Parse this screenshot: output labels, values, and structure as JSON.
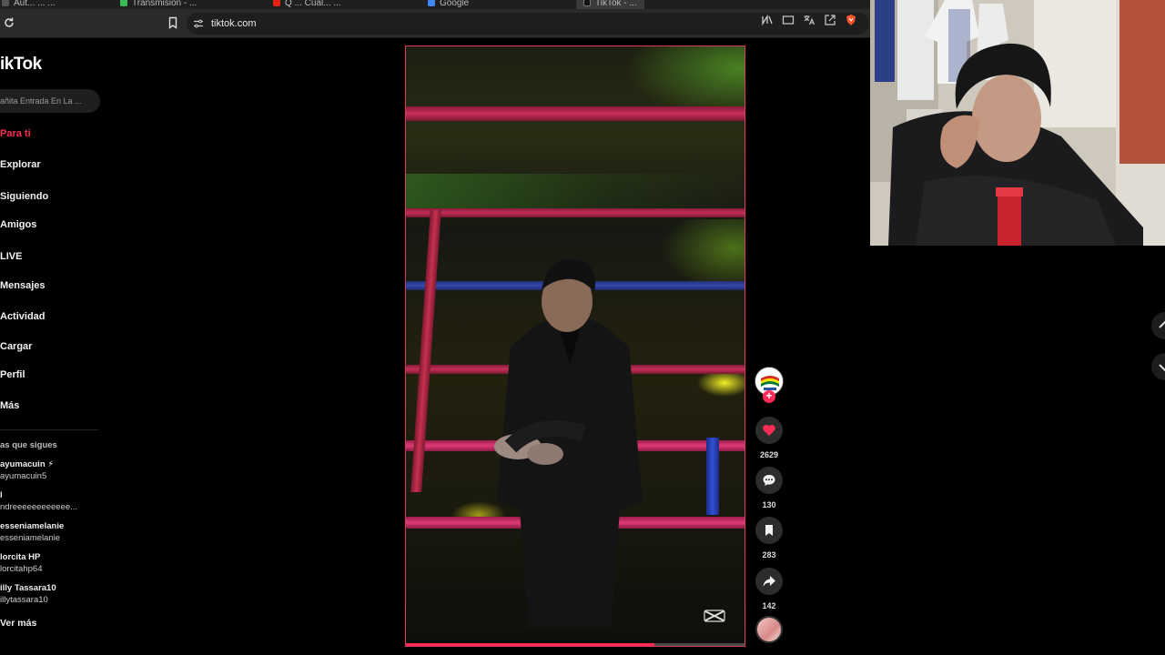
{
  "browser": {
    "tabs": [
      {
        "label": "Aut... ...   ...",
        "active": false
      },
      {
        "label": "Transmisión - ...",
        "active": false
      },
      {
        "label": "Q ... Cual... ...",
        "active": false
      },
      {
        "label": "Google",
        "active": false
      },
      {
        "label": "TikTok - ...",
        "active": true
      }
    ],
    "url": "tiktok.com"
  },
  "sidebar": {
    "logo": "ikTok",
    "search_placeholder": "añita Entrada En La ...",
    "nav": [
      {
        "label": "Para ti",
        "active": true
      },
      {
        "label": "Explorar"
      },
      {
        "label": "Siguiendo"
      },
      {
        "label": "Amigos"
      },
      {
        "label": "LIVE"
      },
      {
        "label": "Mensajes"
      },
      {
        "label": "Actividad"
      },
      {
        "label": "Cargar"
      },
      {
        "label": "Perfil"
      },
      {
        "label": "Más"
      }
    ],
    "following_title": "as que sigues",
    "accounts": [
      {
        "name": "ayumacuin ⚡",
        "handle": "ayumacuin5"
      },
      {
        "name": "",
        "handle": "ndreeeeeeeeeeee..."
      },
      {
        "name": "esseniamelanie",
        "handle": "esseniamelanie"
      },
      {
        "name": "lorcita HP",
        "handle": "lorcitahp64"
      },
      {
        "name": "illy Tassara10",
        "handle": "illytassara10"
      }
    ],
    "see_more": "Ver más"
  },
  "video": {
    "progress": 0.73
  },
  "actions": {
    "likes": "2629",
    "comments": "130",
    "saves": "283",
    "shares": "142"
  },
  "colors": {
    "accent": "#fe2c55",
    "background": "#000000",
    "sidebar_item_bg": "#1f1f1f"
  }
}
